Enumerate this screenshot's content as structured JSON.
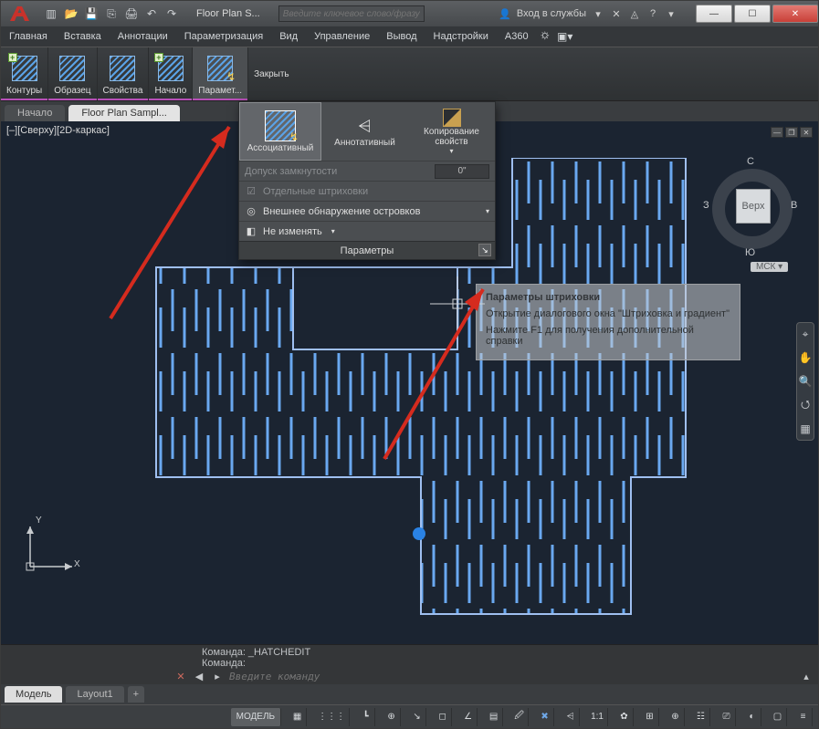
{
  "title_doc": "Floor Plan S...",
  "search_placeholder": "Введите ключевое слово/фразу",
  "signin_label": "Вход в службы",
  "menubar": [
    "Главная",
    "Вставка",
    "Аннотации",
    "Параметризация",
    "Вид",
    "Управление",
    "Вывод",
    "Надстройки",
    "A360"
  ],
  "ribbon": {
    "contours": "Контуры",
    "sample": "Образец",
    "properties": "Свойства",
    "origin": "Начало",
    "options": "Парамет...",
    "close": "Закрыть"
  },
  "doc_tabs": {
    "home": "Начало",
    "active": "Floor Plan Sampl..."
  },
  "viewport_label": "[–][Сверху][2D-каркас]",
  "dropdown": {
    "assoc": "Ассоциативный",
    "annot": "Аннотативный",
    "matchprops": "Копирование свойств",
    "gap_label": "Допуск замкнутости",
    "gap_value": "0\"",
    "separate": "Отдельные штриховки",
    "islands": "Внешнее обнаружение островков",
    "nochange": "Не изменять",
    "footer": "Параметры"
  },
  "tooltip": {
    "title": "Параметры штриховки",
    "line1": "Открытие диалогового окна \"Штриховка и градиент\"",
    "line2": "Нажмите F1 для получения дополнительной справки"
  },
  "viewcube": {
    "face": "Верх",
    "n": "С",
    "s": "Ю",
    "w": "З",
    "e": "В",
    "wcs": "МСК"
  },
  "cmd": {
    "hist1": "Команда: _HATCHEDIT",
    "hist2": "Команда:",
    "placeholder": "Введите команду",
    "arrow": "▸"
  },
  "model_tabs": {
    "model": "Модель",
    "layout1": "Layout1"
  },
  "status": {
    "model": "МОДЕЛЬ",
    "scale": "1:1"
  },
  "ucs": {
    "x": "X",
    "y": "Y"
  },
  "colors": {
    "accent": "#b84fb8",
    "hatch": "#5aa2e6",
    "arrow": "#d52b1e"
  }
}
